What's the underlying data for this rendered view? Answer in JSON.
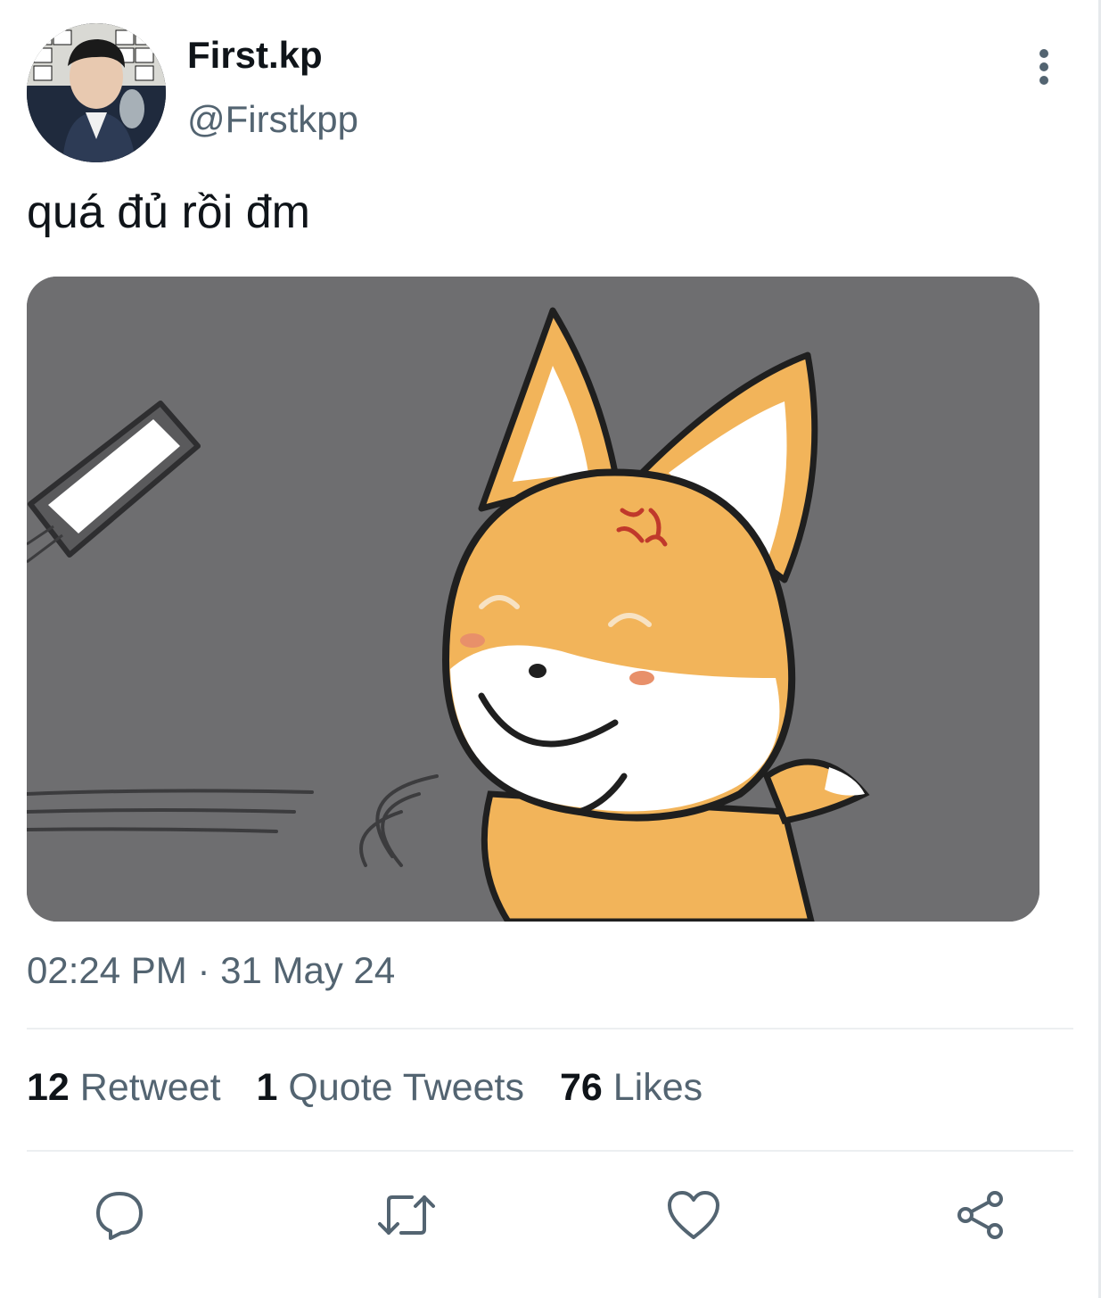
{
  "tweet": {
    "display_name": "First.kp",
    "handle": "@Firstkpp",
    "text": "quá đủ rồi đm",
    "timestamp": "02:24 PM · 31 May 24",
    "media_alt_icon": "angry-fox-meme-image"
  },
  "stats": {
    "retweet_count": "12",
    "retweet_label": "Retweet",
    "quote_count": "1",
    "quote_label": "Quote Tweets",
    "like_count": "76",
    "like_label": "Likes"
  },
  "actions": {
    "reply_icon": "reply-icon",
    "retweet_icon": "retweet-icon",
    "like_icon": "heart-icon",
    "share_icon": "share-icon",
    "more_icon": "more-vertical-icon"
  },
  "colors": {
    "text_primary": "#0f1419",
    "text_secondary": "#536471",
    "divider": "#eceff1",
    "media_bg": "#6e6e70",
    "fox_orange": "#f2b45a"
  }
}
